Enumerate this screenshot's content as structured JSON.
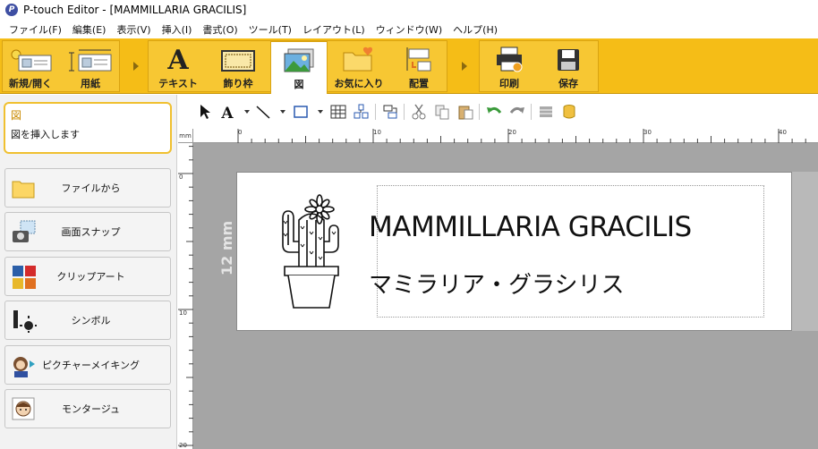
{
  "window": {
    "title": "P-touch Editor - [MAMMILLARIA GRACILIS]"
  },
  "menubar": {
    "items": [
      "ファイル(F)",
      "編集(E)",
      "表示(V)",
      "挿入(I)",
      "書式(O)",
      "ツール(T)",
      "レイアウト(L)",
      "ウィンドウ(W)",
      "ヘルプ(H)"
    ]
  },
  "ribbon": {
    "new_open": "新規/開く",
    "paper": "用紙",
    "text": "テキスト",
    "frame": "飾り枠",
    "image": "図",
    "favorites": "お気に入り",
    "arrange": "配置",
    "print": "印刷",
    "save": "保存",
    "accent_color": "#f5bd17"
  },
  "left_pane": {
    "info_title": "図",
    "info_desc": "図を挿入します",
    "buttons": [
      {
        "label": "ファイルから",
        "icon": "folder-icon"
      },
      {
        "label": "画面スナップ",
        "icon": "camera-icon"
      },
      {
        "label": "クリップアート",
        "icon": "clipart-icon"
      },
      {
        "label": "シンボル",
        "icon": "symbol-icon"
      },
      {
        "label": "ピクチャーメイキング",
        "icon": "picture-making-icon"
      },
      {
        "label": "モンタージュ",
        "icon": "montage-icon"
      }
    ]
  },
  "rulers": {
    "unit": "mm",
    "h_ticks": [
      "0",
      "10",
      "20",
      "30",
      "40"
    ],
    "v_ticks": [
      "0",
      "10",
      "20"
    ]
  },
  "label": {
    "size": "12 mm",
    "title": "MAMMILLARIA GRACILIS",
    "subtitle": "マミラリア・グラシリス"
  }
}
